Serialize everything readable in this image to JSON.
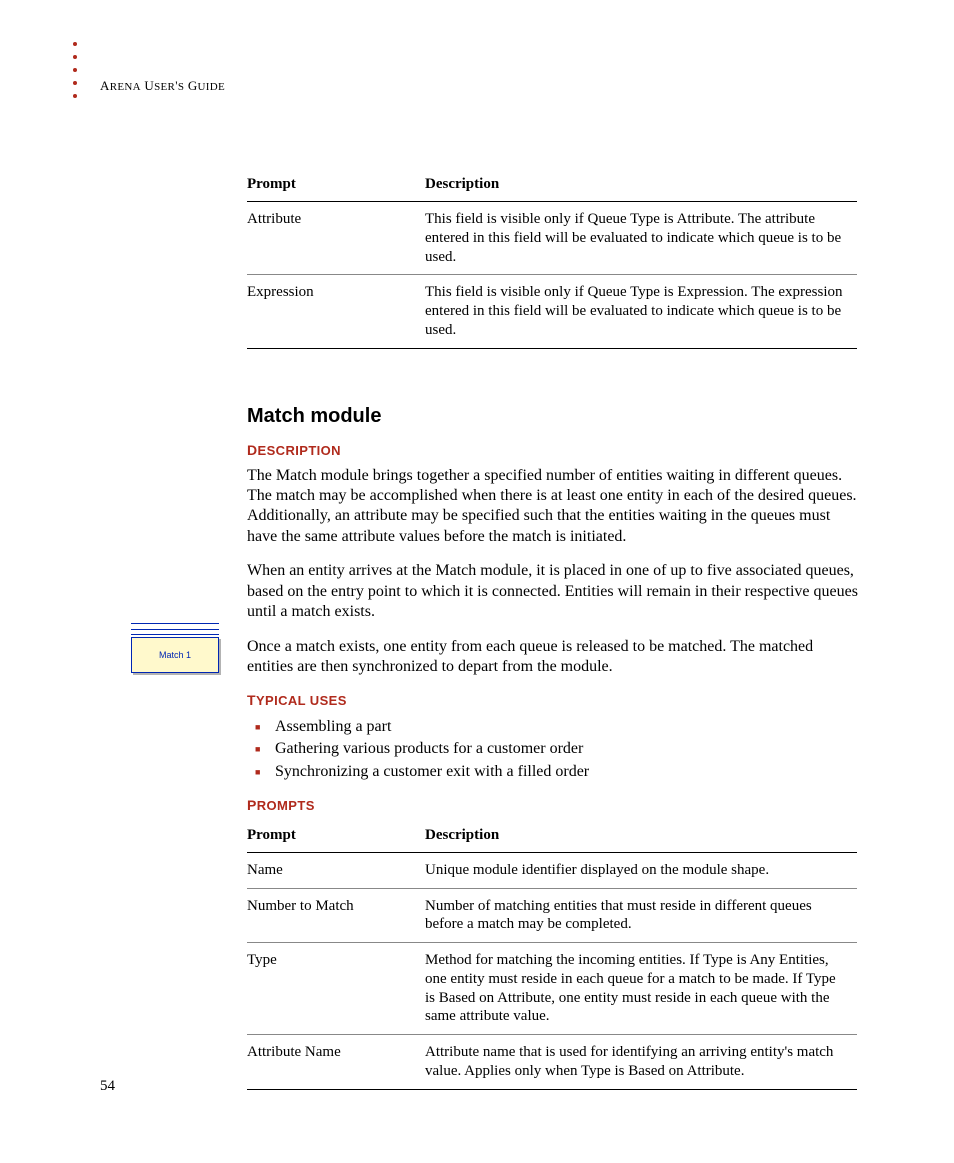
{
  "running_head": "Arena User's Guide",
  "page_number": "54",
  "top_table": {
    "headers": [
      "Prompt",
      "Description"
    ],
    "rows": [
      {
        "prompt": "Attribute",
        "desc": "This field is visible only if Queue Type is Attribute. The attribute entered in this field will be evaluated to indicate which queue is to be used."
      },
      {
        "prompt": "Expression",
        "desc": "This field is visible only if Queue Type is Expression. The expression entered in this field will be evaluated to indicate which queue is to be used."
      }
    ]
  },
  "section_title": "Match module",
  "module_label": "Match 1",
  "desc_heading": "Description",
  "desc_paras": [
    "The Match module brings together a specified number of entities waiting in different queues. The match may be accomplished when there is at least one entity in each of the desired queues. Additionally, an attribute may be specified such that the entities waiting in the queues must have the same attribute values before the match is initiated.",
    "When an entity arrives at the Match module, it is placed in one of up to five associated queues, based on the entry point to which it is connected. Entities will remain in their respective queues until a match exists.",
    "Once a match exists, one entity from each queue is released to be matched. The matched entities are then synchronized to depart from the module."
  ],
  "uses_heading": "Typical uses",
  "uses": [
    "Assembling a part",
    "Gathering various products for a customer order",
    "Synchronizing a customer exit with a filled order"
  ],
  "prompts_heading": "Prompts",
  "prompts_table": {
    "headers": [
      "Prompt",
      "Description"
    ],
    "rows": [
      {
        "prompt": "Name",
        "desc": "Unique module identifier displayed on the module shape."
      },
      {
        "prompt": "Number to Match",
        "desc": "Number of matching entities that must reside in different queues before a match may be completed."
      },
      {
        "prompt": "Type",
        "desc": "Method for matching the incoming entities. If Type is Any Entities, one entity must reside in each queue for a match to be made. If Type is Based on Attribute, one entity must reside in each queue with the same attribute value."
      },
      {
        "prompt": "Attribute Name",
        "desc": "Attribute name that is used for identifying an arriving entity's match value. Applies only when Type is Based on Attribute."
      }
    ]
  }
}
